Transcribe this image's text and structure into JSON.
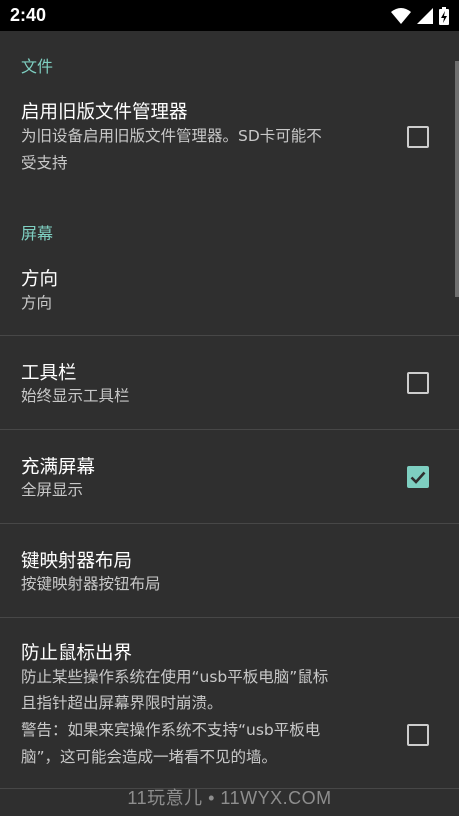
{
  "status_bar": {
    "time": "2:40"
  },
  "colors": {
    "accent": "#7ecfc1",
    "background": "#2f2f2f",
    "status_bar": "#000000"
  },
  "sections": {
    "files": {
      "header": "文件"
    },
    "screen": {
      "header": "屏幕"
    }
  },
  "prefs": {
    "legacy_file_manager": {
      "title": "启用旧版文件管理器",
      "summary_line1": "为旧设备启用旧版文件管理器。SD卡可能不",
      "summary_line2": "受支持",
      "checked": false
    },
    "orientation": {
      "title": "方向",
      "summary": "方向"
    },
    "toolbar": {
      "title": "工具栏",
      "summary": "始终显示工具栏",
      "checked": false
    },
    "fullscreen": {
      "title": "充满屏幕",
      "summary": "全屏显示",
      "checked": true
    },
    "keymapper_layout": {
      "title": "键映射器布局",
      "summary": "按键映射器按钮布局"
    },
    "prevent_mouse_exit": {
      "title": "防止鼠标出界",
      "summary_line1": "防止某些操作系统在使用“usb平板电脑”鼠标",
      "summary_line2": "且指针超出屏幕界限时崩溃。",
      "summary_line3": "警告：如果来宾操作系统不支持“usb平板电",
      "summary_line4": "脑”，这可能会造成一堵看不见的墙。",
      "checked": false
    }
  },
  "watermark": "11玩意儿 • 11WYX.COM"
}
